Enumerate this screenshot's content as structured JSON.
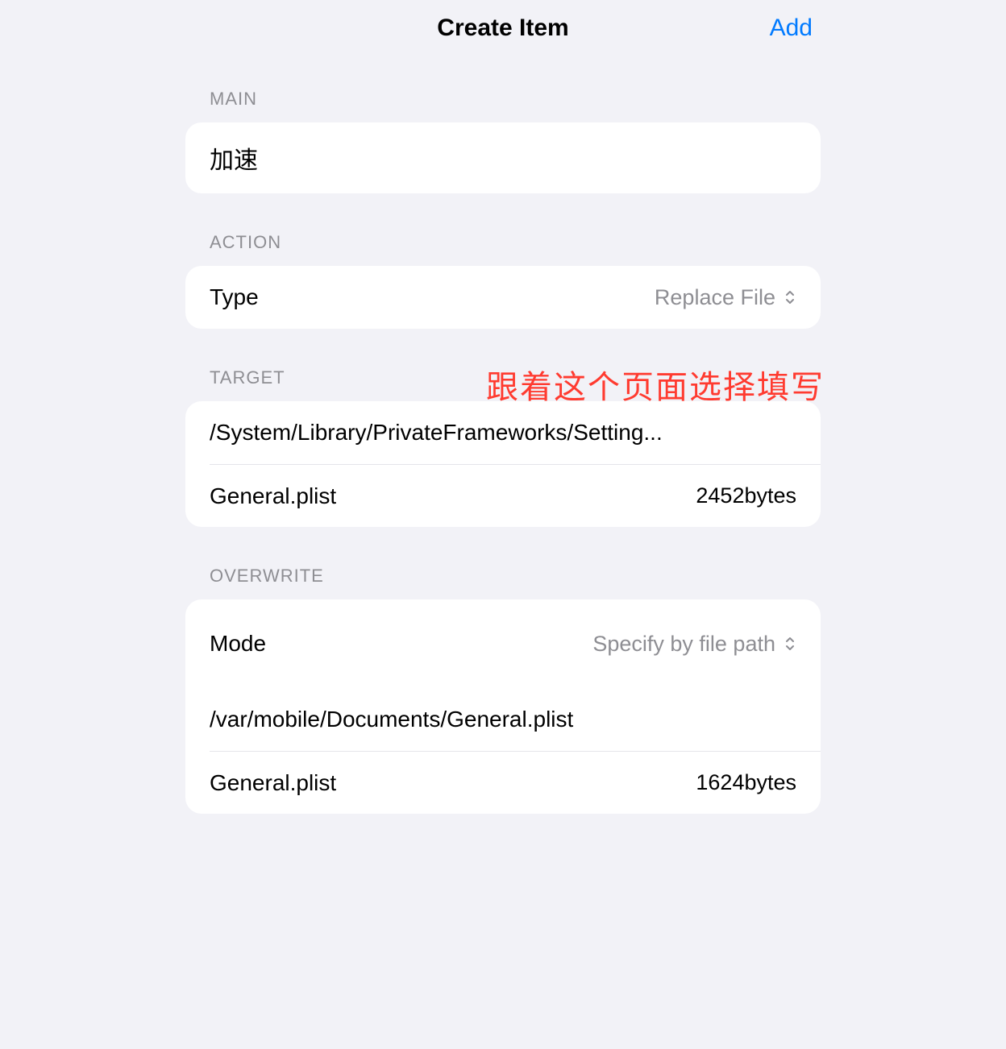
{
  "nav": {
    "title": "Create Item",
    "add": "Add"
  },
  "annotation": "跟着这个页面选择填写",
  "main": {
    "header": "MAIN",
    "value": "加速"
  },
  "action": {
    "header": "ACTION",
    "type_label": "Type",
    "type_value": "Replace File"
  },
  "target": {
    "header": "TARGET",
    "path": "/System/Library/PrivateFrameworks/Setting...",
    "filename": "General.plist",
    "size": "2452bytes"
  },
  "overwrite": {
    "header": "OVERWRITE",
    "mode_label": "Mode",
    "mode_value": "Specify by file path",
    "path": "/var/mobile/Documents/General.plist",
    "filename": "General.plist",
    "size": "1624bytes"
  }
}
